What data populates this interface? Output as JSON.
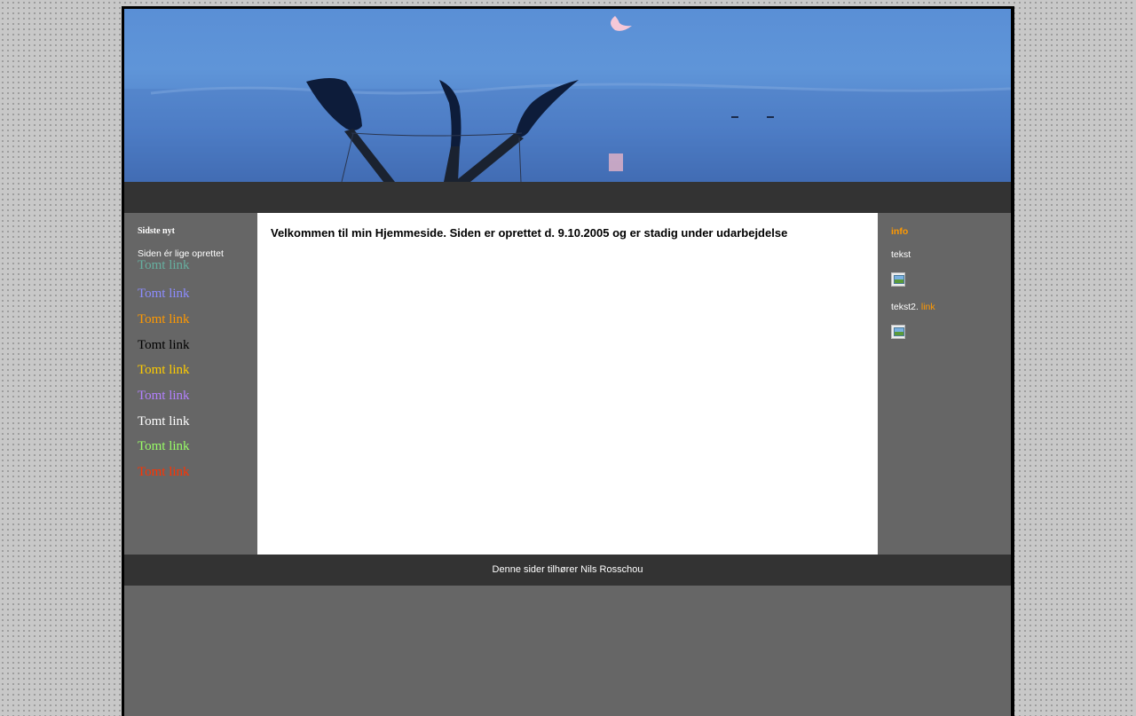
{
  "left": {
    "news_title": "Sidste nyt",
    "news_text": "Siden ér lige oprettet",
    "links": [
      {
        "label": "Tomt link",
        "color": "#66b0a0"
      },
      {
        "label": "Tomt link",
        "color": "#8c8cff"
      },
      {
        "label": "Tomt link",
        "color": "#ff9900"
      },
      {
        "label": "Tomt link",
        "color": "#000000"
      },
      {
        "label": "Tomt link",
        "color": "#ffcc00"
      },
      {
        "label": "Tomt link",
        "color": "#b380ff"
      },
      {
        "label": "Tomt link",
        "color": "#ffffff"
      },
      {
        "label": "Tomt link",
        "color": "#99ff66"
      },
      {
        "label": "Tomt link",
        "color": "#ff3300"
      }
    ]
  },
  "main": {
    "welcome_text": "Velkommen til min Hjemmeside. Siden er  oprettet d. 9.10.2005 og er stadig under udarbejdelse"
  },
  "right": {
    "info_title": "info",
    "text1": "tekst",
    "text2": "tekst2.",
    "link_label": "link"
  },
  "footer": {
    "text": "Denne sider tilhører Nils Rosschou"
  },
  "colors": {
    "background": "#c8c8c8",
    "panel": "#666666",
    "bar": "#333333",
    "accent": "#ff9900"
  }
}
